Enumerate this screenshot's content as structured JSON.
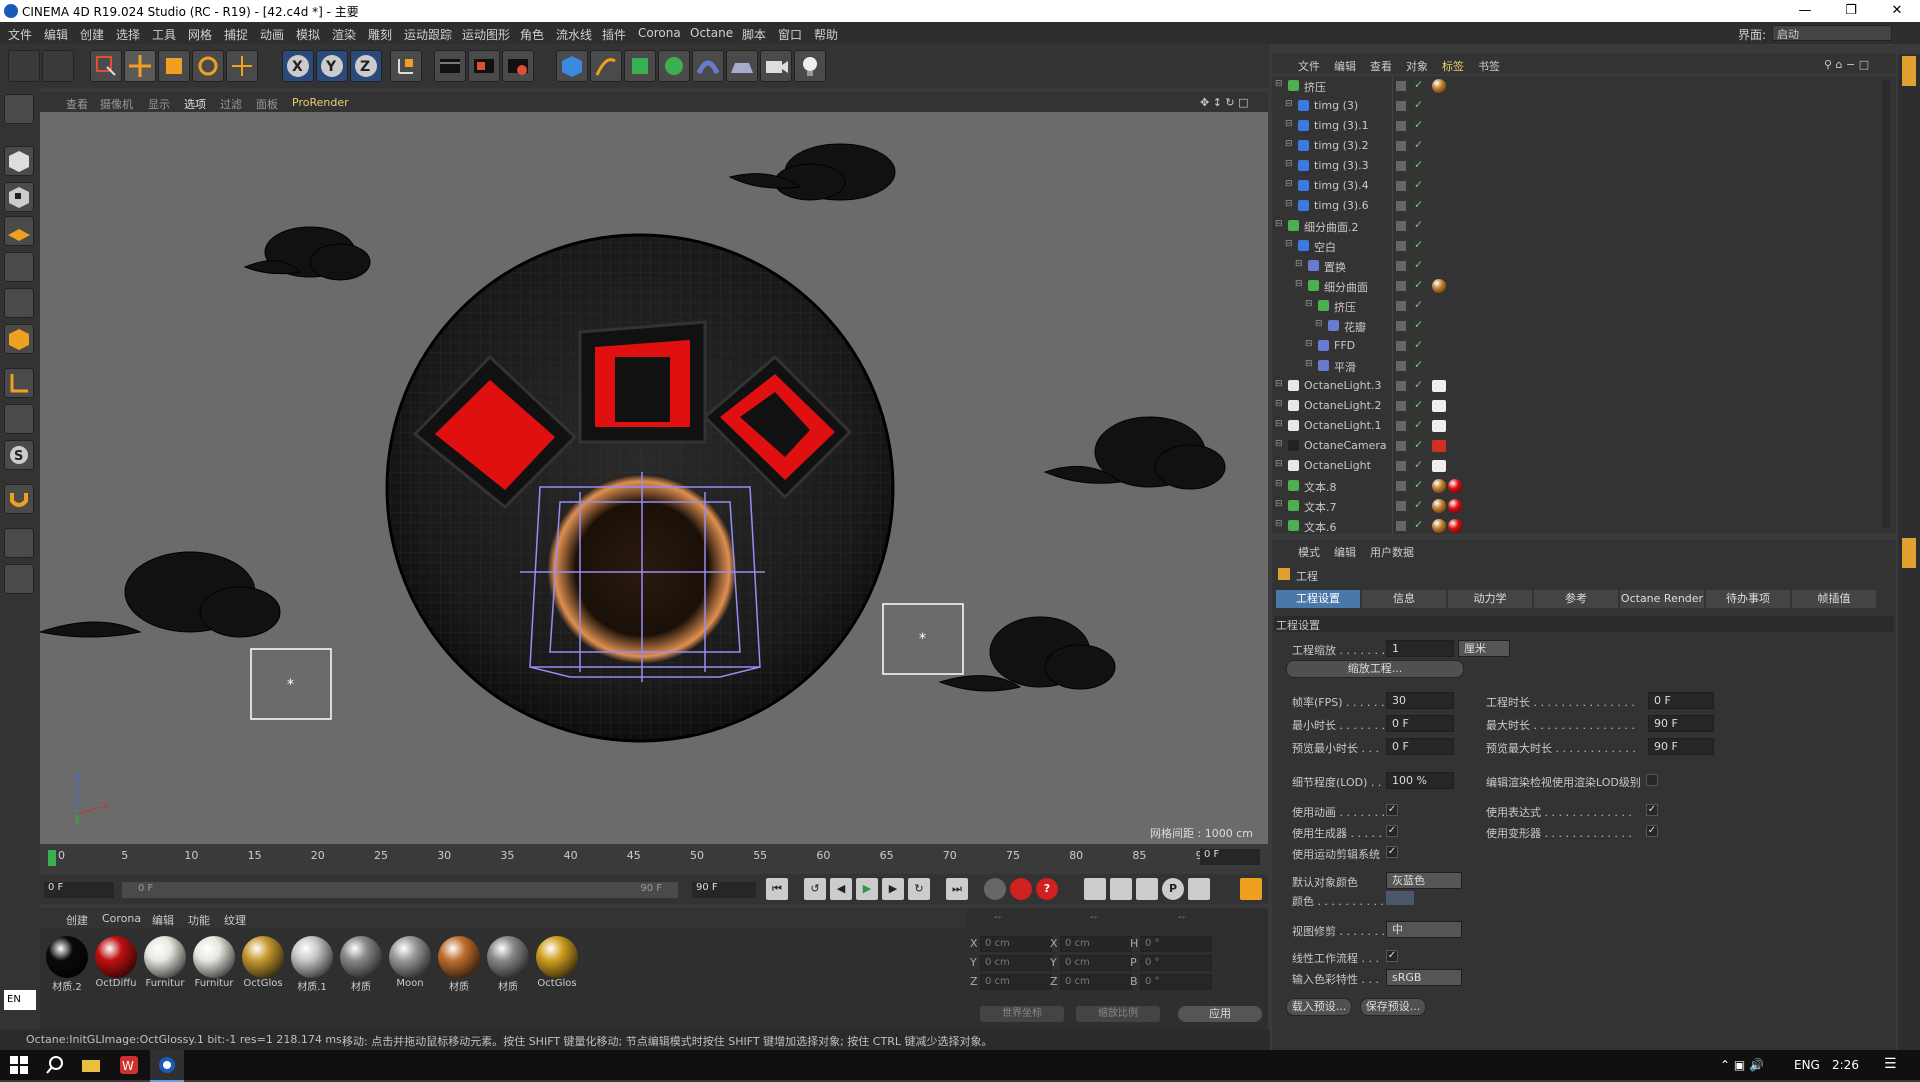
{
  "window": {
    "title": "CINEMA 4D R19.024 Studio (RC - R19) - [42.c4d *] - 主要",
    "interface_label": "界面:",
    "interface_value": "启动"
  },
  "menu": [
    "文件",
    "编辑",
    "创建",
    "选择",
    "工具",
    "网格",
    "捕捉",
    "动画",
    "模拟",
    "渲染",
    "雕刻",
    "运动跟踪",
    "运动图形",
    "角色",
    "流水线",
    "插件",
    "Corona",
    "Octane",
    "脚本",
    "窗口",
    "帮助"
  ],
  "viewport": {
    "menu": [
      "查看",
      "摄像机",
      "显示",
      "选项",
      "过滤",
      "面板",
      "ProRender"
    ],
    "grid_spacing": "网格间距 : 1000 cm",
    "axis_labels": {
      "y": "Y",
      "z": "Z",
      "x": "X"
    }
  },
  "timeline": {
    "ticks": [
      "0",
      "5",
      "10",
      "15",
      "20",
      "25",
      "30",
      "35",
      "40",
      "45",
      "50",
      "55",
      "60",
      "65",
      "70",
      "75",
      "80",
      "85",
      "90"
    ],
    "current_frame": "0 F",
    "start_field": "0 F",
    "range_start": "0 F",
    "range_end": "90 F",
    "end_field": "90 F"
  },
  "materials": {
    "menu": [
      "创建",
      "Corona",
      "编辑",
      "功能",
      "纹理"
    ],
    "items": [
      {
        "label": "材质.2",
        "color": "#0a0a0a"
      },
      {
        "label": "OctDiffu",
        "color": "#c01010"
      },
      {
        "label": "Furnitur",
        "color": "#e8e8e0"
      },
      {
        "label": "Furnitur",
        "color": "#e8e8e0"
      },
      {
        "label": "OctGlos",
        "color": "#c89a30"
      },
      {
        "label": "材质.1",
        "color": "#c8c8c8"
      },
      {
        "label": "材质",
        "color": "#8a8a8a"
      },
      {
        "label": "Moon",
        "color": "#9a9a9a"
      },
      {
        "label": "材质",
        "color": "#c07030"
      },
      {
        "label": "材质",
        "color": "#8a8a8a"
      },
      {
        "label": "OctGlos",
        "color": "#d0a020"
      }
    ]
  },
  "coords": {
    "headers": [
      "--",
      "--",
      "--"
    ],
    "rows": [
      {
        "a": "X",
        "av": "0 cm",
        "b": "X",
        "bv": "0 cm",
        "c": "H",
        "cv": "0 °"
      },
      {
        "a": "Y",
        "av": "0 cm",
        "b": "Y",
        "bv": "0 cm",
        "c": "P",
        "cv": "0 °"
      },
      {
        "a": "Z",
        "av": "0 cm",
        "b": "Z",
        "bv": "0 cm",
        "c": "B",
        "cv": "0 °"
      }
    ],
    "world_coords": "世界坐标",
    "scale": "缩放比例",
    "apply": "应用"
  },
  "status": "Octane:InitGLImage:OctGlossy.1  bit:-1 res=1  218.174 ms.",
  "status_hint": "移动: 点击并拖动鼠标移动元素。按住 SHIFT 键量化移动; 节点编辑模式时按住 SHIFT 键增加选择对象; 按住 CTRL 键减少选择对象。",
  "language_indicator": "EN",
  "object_manager": {
    "menu": [
      "文件",
      "编辑",
      "查看",
      "对象",
      "标签",
      "书签"
    ],
    "rows": [
      {
        "name": "挤压",
        "indent": 0,
        "icon": "#4caf50"
      },
      {
        "name": "timg (3)",
        "indent": 1,
        "icon": "#3c7ae0"
      },
      {
        "name": "timg (3).1",
        "indent": 1,
        "icon": "#3c7ae0"
      },
      {
        "name": "timg (3).2",
        "indent": 1,
        "icon": "#3c7ae0"
      },
      {
        "name": "timg (3).3",
        "indent": 1,
        "icon": "#3c7ae0"
      },
      {
        "name": "timg (3).4",
        "indent": 1,
        "icon": "#3c7ae0"
      },
      {
        "name": "timg (3).6",
        "indent": 1,
        "icon": "#3c7ae0"
      },
      {
        "name": "细分曲面.2",
        "indent": 0,
        "icon": "#4caf50"
      },
      {
        "name": "空白",
        "indent": 1,
        "icon": "#3c7ae0"
      },
      {
        "name": "置换",
        "indent": 2,
        "icon": "#6a7ad0"
      },
      {
        "name": "细分曲面",
        "indent": 2,
        "icon": "#4caf50"
      },
      {
        "name": "挤压",
        "indent": 3,
        "icon": "#4caf50"
      },
      {
        "name": "花瓣",
        "indent": 4,
        "icon": "#6a7ad0"
      },
      {
        "name": "FFD",
        "indent": 3,
        "icon": "#6a7ad0"
      },
      {
        "name": "平滑",
        "indent": 3,
        "icon": "#6a7ad0"
      },
      {
        "name": "OctaneLight.3",
        "indent": 0,
        "icon": "#e8e8e8"
      },
      {
        "name": "OctaneLight.2",
        "indent": 0,
        "icon": "#e8e8e8"
      },
      {
        "name": "OctaneLight.1",
        "indent": 0,
        "icon": "#e8e8e8"
      },
      {
        "name": "OctaneCamera",
        "indent": 0,
        "icon": "#222222"
      },
      {
        "name": "OctaneLight",
        "indent": 0,
        "icon": "#e8e8e8"
      },
      {
        "name": "文本.8",
        "indent": 0,
        "icon": "#4caf50"
      },
      {
        "name": "文本.7",
        "indent": 0,
        "icon": "#4caf50"
      },
      {
        "name": "文本.6",
        "indent": 0,
        "icon": "#4caf50"
      }
    ]
  },
  "attributes": {
    "menu": [
      "模式",
      "编辑",
      "用户数据"
    ],
    "section": "工程",
    "tabs": [
      "工程设置",
      "信息",
      "动力学",
      "参考",
      "Octane Render",
      "待办事项",
      "帧插值"
    ],
    "group": "工程设置",
    "project_scale_label": "工程缩放 . . . . . . .",
    "project_scale_value": "1",
    "project_scale_unit": "厘米",
    "scale_project_btn": "缩放工程...",
    "fps_label": "帧率(FPS) . . . . . . .",
    "fps_value": "30",
    "project_time_label": "工程时长 . . . . . . . . . . . . . . .",
    "project_time_value": "0 F",
    "min_time_label": "最小时长 . . . . . . . .",
    "min_time_value": "0 F",
    "max_time_label": "最大时长 . . . . . . . . . . . . . . .",
    "max_time_value": "90 F",
    "preview_min_label": "预览最小时长 . . .",
    "preview_min_value": "0 F",
    "preview_max_label": "预览最大时长 . . . . . . . . . . . .",
    "preview_max_value": "90 F",
    "lod_label": "细节程度(LOD) . . .",
    "lod_value": "100 %",
    "lod_render_label": "编辑渲染检视使用渲染LOD级别",
    "use_anim_label": "使用动画 . . . . . . . .",
    "use_expr_label": "使用表达式 . . . . . . . . . . . . .",
    "use_gen_label": "使用生成器 . . . . . . .",
    "use_deform_label": "使用变形器 . . . . . . . . . . . . .",
    "use_mograph_label": "使用运动剪辑系统",
    "default_color_label": "默认对象颜色",
    "default_color_value": "灰蓝色",
    "color_label": "颜色 . . . . . . . . . . .",
    "view_clip_label": "视图修剪 . . . . . . . .",
    "view_clip_value": "中",
    "linear_label": "线性工作流程 . . .",
    "input_color_label": "输入色彩特性 . . .",
    "input_color_value": "sRGB",
    "load_preset": "载入预设...",
    "save_preset": "保存预设..."
  },
  "taskbar": {
    "lang": "ENG",
    "time": "2:26"
  },
  "colors": {
    "accent": "#4a79a9",
    "red": "#e01010",
    "viewport_bg": "#6b6b6b"
  }
}
